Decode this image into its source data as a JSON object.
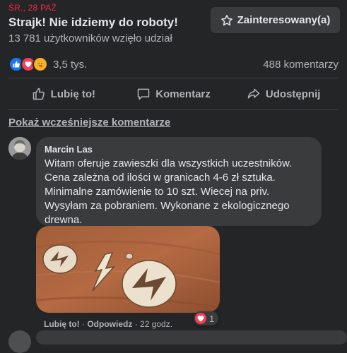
{
  "event": {
    "date": "ŚR., 28 PAŹ",
    "title": "Strajk! Nie idziemy do roboty!",
    "participants": "13 781 użytkowników wzięło udział",
    "interested_label": "Zainteresowany(a)",
    "interested_icon": "star-outline-icon"
  },
  "reactions": {
    "icons": [
      "like-icon",
      "love-icon",
      "care-icon"
    ],
    "count": "3,5 tys.",
    "comments": "488 komentarzy"
  },
  "actions": {
    "like": "Lubię to!",
    "comment": "Komentarz",
    "share": "Udostępnij"
  },
  "comments_section": {
    "show_previous": "Pokaż wcześniejsze komentarze"
  },
  "comment": {
    "author": "Marcin Las",
    "text": "Witam oferuje zawieszki dla wszystkich uczestników.\nCena zależna od ilości w granicach 4-6 zł sztuka.\nMinimalne zamówienie to 10 szt. Wiecej na priv.\nWysyłam za pobraniem. Wykonane z ekologicznego\ndrewna.",
    "reaction_count": "1",
    "like_label": "Lubię to!",
    "reply_label": "Odpowiedz",
    "time": "22 godz."
  },
  "colors": {
    "background": "#242526",
    "bubble": "#3a3b3c",
    "date_accent": "#f02849",
    "like_blue": "#1877f2",
    "love_red": "#f33e58"
  }
}
